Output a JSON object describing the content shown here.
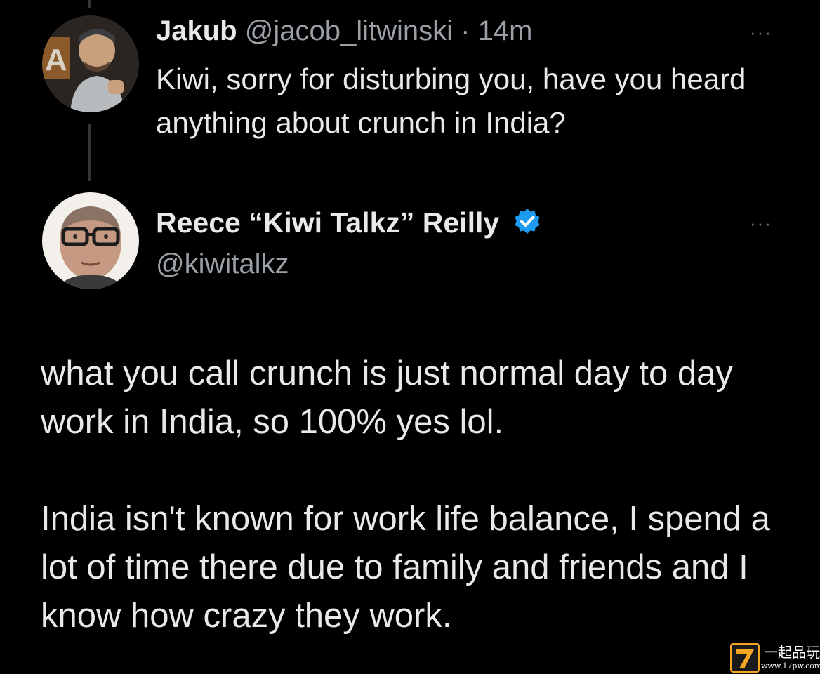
{
  "tweet": {
    "name": "Jakub",
    "handle": "@jacob_litwinski",
    "separator": "·",
    "time": "14m",
    "text": "Kiwi, sorry for disturbing you, have you heard anything about crunch in India?",
    "more_label": "···"
  },
  "reply": {
    "name": "Reece “Kiwi Talkz” Reilly",
    "handle": "@kiwitalkz",
    "more_label": "···",
    "paragraphs": [
      "what you call crunch is just normal day to day work in India, so 100% yes lol.",
      "India isn't known for work life balance, I spend a lot of time there due to family and friends and I know how crazy they work."
    ]
  },
  "watermark": {
    "text": "一起品玩",
    "url": "www.17pw.com"
  },
  "colors": {
    "background": "#000000",
    "text_primary": "#e7e9ea",
    "text_secondary": "#9aa0a6",
    "thread_line": "#333639",
    "verified_badge": "#1d9bf0",
    "watermark_accent": "#f5a623"
  },
  "icons": {
    "verified": "verified-badge-icon",
    "more": "more-options-icon"
  }
}
